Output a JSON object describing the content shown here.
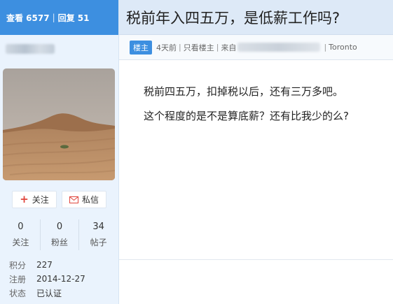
{
  "post_stats": {
    "views_label": "查看 6577",
    "separator": "|",
    "replies_label": "回复 51"
  },
  "post": {
    "title": "税前年入四五万，是低薪工作吗?",
    "op_badge": "楼主",
    "time": "4天前",
    "only_op": "只看楼主",
    "source_prefix": "来自",
    "location": "Toronto",
    "paragraphs": [
      "税前四五万，扣掉税以后，还有三万多吧。",
      "这个程度的是不是算底薪？还有比我少的么?"
    ]
  },
  "author": {
    "avatar_icon": "desert-dunes-avatar",
    "follow_label": "关注",
    "message_label": "私信",
    "counters": [
      {
        "value": "0",
        "label": "关注"
      },
      {
        "value": "0",
        "label": "粉丝"
      },
      {
        "value": "34",
        "label": "帖子"
      }
    ],
    "info": [
      {
        "key": "积分",
        "value": "227"
      },
      {
        "key": "注册",
        "value": "2014-12-27"
      },
      {
        "key": "状态",
        "value": "已认证"
      }
    ]
  },
  "colors": {
    "accent": "#3d8fe0",
    "sidebar_bg": "#eaf3fd",
    "title_bg": "#dde9f7",
    "follow_plus": "#e0453c"
  }
}
